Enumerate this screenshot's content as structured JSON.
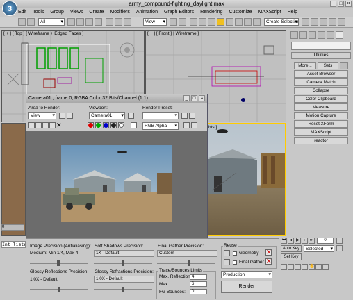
{
  "window": {
    "title": "army_compound-fighting_daylight.max",
    "logo": "3"
  },
  "menu": [
    "Edit",
    "Tools",
    "Group",
    "Views",
    "Create",
    "Modifiers",
    "Animation",
    "Graph Editors",
    "Rendering",
    "Customize",
    "MAXScript",
    "Help"
  ],
  "toolbar": {
    "selection_filter": "All",
    "ref_coord": "View",
    "named_selection": "Create Selection Se"
  },
  "viewports": {
    "top": "[ + ] [ Top ] [ Wireframe + Edged Faces ]",
    "front": "[ + ] [ Front ] [ Wireframe ]",
    "persp_suffix": "hts ]"
  },
  "cmd": {
    "utilities_header": "Utilities",
    "more": "More...",
    "sets": "Sets",
    "items": [
      "Asset Browser",
      "Camera Match",
      "Collapse",
      "Color Clipboard",
      "Measure",
      "Motion Capture",
      "Reset XForm",
      "MAXScript",
      "reactor"
    ]
  },
  "render_window": {
    "title": "Camera01 , frame 0, RGBA Color 32 Bits/Channel (1:1)",
    "area_label": "Area to Render:",
    "area_value": "View",
    "viewport_label": "Viewport:",
    "viewport_value": "Camera01",
    "preset_label": "Render Preset:",
    "preset_value": "",
    "channel": "RGB Alpha"
  },
  "render_panel": {
    "image_precision_label": "Image Precision (Antialiasing):",
    "image_precision_value": "Medium: Min 1/4, Max 4",
    "soft_shadows_label": "Soft Shadows Precision:",
    "soft_shadows_value": "1X - Default",
    "final_gather_label": "Final Gather Precision:",
    "final_gather_value": "Custom",
    "reuse_label": "Reuse",
    "geometry_label": "Geometry",
    "final_gather_chk_label": "Final Gather",
    "glossy_refl_label": "Glossy Reflections Precision:",
    "glossy_refl_value": "1.0X - Default",
    "glossy_refr_label": "Glossy Refractions Precision:",
    "glossy_refr_value": "1.0X - Default",
    "trace_label": "Trace/Bounces Limits",
    "max_refl_label": "Max. Reflections:",
    "max_refl_value": "4",
    "max_label": "Max.",
    "max_value": "6",
    "fg_bounces_label": "FG Bounces:",
    "fg_bounces_value": "0",
    "production_value": "Production",
    "render_button": "Render"
  },
  "status": {
    "script_listener": "Int listen",
    "timeline_frame": "0",
    "auto_key": "Auto Key",
    "selected": "Selected",
    "set_key": "Set Key"
  },
  "colors": {
    "viewport_bg": "#c0c0c0",
    "active_border": "#ffcc00",
    "render_bg": "#6c6c6c"
  }
}
